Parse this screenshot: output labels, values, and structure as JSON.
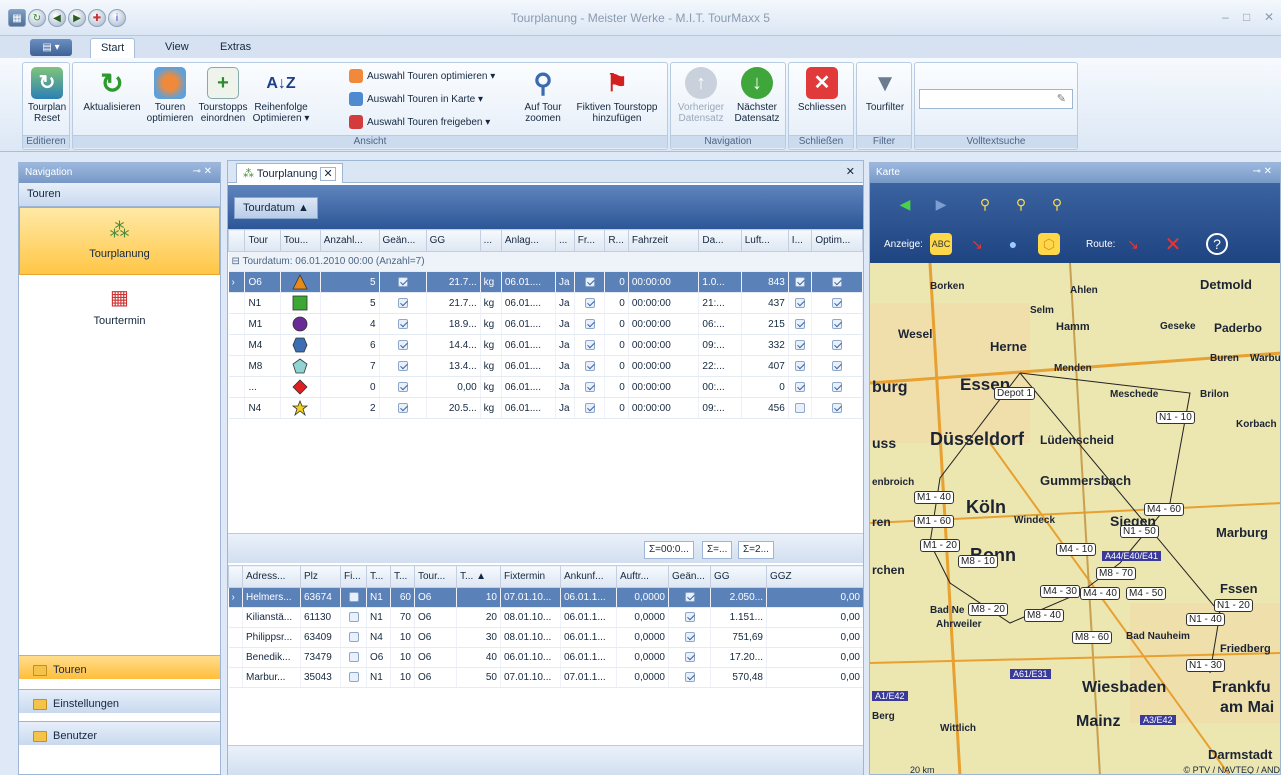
{
  "window": {
    "title": "Tourplanung - Meister Werke - M.I.T. TourMaxx 5",
    "controls": [
      "–",
      "□",
      "✕"
    ]
  },
  "ribbon": {
    "tabs": [
      "Start",
      "View",
      "Extras"
    ],
    "groups": {
      "edit": "Editieren",
      "view": "Ansicht",
      "nav": "Navigation",
      "close": "Schließen",
      "filter": "Filter",
      "search": "Volltextsuche"
    },
    "buttons": {
      "reset": "Tourplan\nReset",
      "refresh": "Aktualisieren",
      "optimize": "Touren\noptimieren",
      "stops": "Tourstopps\neinordnen",
      "order": "Reihenfolge\nOptimieren ▾",
      "zoom": "Auf Tour\nzoomen",
      "fictive": "Fiktiven Tourstopp\nhinzufügen",
      "prev": "Vorheriger\nDatensatz",
      "next": "Nächster\nDatensatz",
      "close": "Schliessen",
      "filter": "Tourfilter"
    },
    "small": [
      "Auswahl Touren optimieren ▾",
      "Auswahl Touren in Karte ▾",
      "Auswahl Touren freigeben ▾"
    ]
  },
  "nav": {
    "title": "Navigation",
    "section": "Touren",
    "items": [
      {
        "label": "Tourplanung"
      },
      {
        "label": "Tourtermin"
      }
    ],
    "bars": [
      "Touren",
      "Einstellungen",
      "Benutzer"
    ]
  },
  "doc": {
    "tab": "Tourplanung",
    "group_by": "Tourdatum  ▲",
    "group_row": "⊟ Tourdatum: 06.01.2010 00:00 (Anzahl=7)",
    "columns": [
      "Tour",
      "Tou...",
      "Anzahl...",
      "Geän...",
      "GG",
      "...",
      "Anlag...",
      "...",
      "Fr...",
      "R...",
      "Fahrzeit",
      "Da...",
      "Luft...",
      "I...",
      "Optim..."
    ],
    "rows": [
      {
        "tour": "O6",
        "shape": "triangle",
        "color": "#e88a1a",
        "anzahl": "5",
        "geaen": true,
        "gg": "21.7...",
        "unit": "kg",
        "anlag": "06.01....",
        "j": "Ja",
        "fr": true,
        "r": "0",
        "fahr": "00:00:00",
        "da": "1.0...",
        "luft": "843",
        "i": true,
        "opt": true
      },
      {
        "tour": "N1",
        "shape": "square",
        "color": "#3aa832",
        "anzahl": "5",
        "geaen": true,
        "gg": "21.7...",
        "unit": "kg",
        "anlag": "06.01....",
        "j": "Ja",
        "fr": true,
        "r": "0",
        "fahr": "00:00:00",
        "da": "21:...",
        "luft": "437",
        "i": true,
        "opt": true
      },
      {
        "tour": "M1",
        "shape": "circle",
        "color": "#6a2a96",
        "anzahl": "4",
        "geaen": true,
        "gg": "18.9...",
        "unit": "kg",
        "anlag": "06.01....",
        "j": "Ja",
        "fr": true,
        "r": "0",
        "fahr": "00:00:00",
        "da": "06:...",
        "luft": "215",
        "i": true,
        "opt": true
      },
      {
        "tour": "M4",
        "shape": "hexagon",
        "color": "#3d6db3",
        "anzahl": "6",
        "geaen": true,
        "gg": "14.4...",
        "unit": "kg",
        "anlag": "06.01....",
        "j": "Ja",
        "fr": true,
        "r": "0",
        "fahr": "00:00:00",
        "da": "09:...",
        "luft": "332",
        "i": true,
        "opt": true
      },
      {
        "tour": "M8",
        "shape": "pentagon",
        "color": "#8fd3d3",
        "anzahl": "7",
        "geaen": true,
        "gg": "13.4...",
        "unit": "kg",
        "anlag": "06.01....",
        "j": "Ja",
        "fr": true,
        "r": "0",
        "fahr": "00:00:00",
        "da": "22:...",
        "luft": "407",
        "i": true,
        "opt": true
      },
      {
        "tour": "...",
        "shape": "diamond",
        "color": "#e02020",
        "anzahl": "0",
        "geaen": true,
        "gg": "0,00",
        "unit": "kg",
        "anlag": "06.01....",
        "j": "Ja",
        "fr": true,
        "r": "0",
        "fahr": "00:00:00",
        "da": "00:...",
        "luft": "0",
        "i": true,
        "opt": true
      },
      {
        "tour": "N4",
        "shape": "star",
        "color": "#f2d21c",
        "anzahl": "2",
        "geaen": true,
        "gg": "20.5...",
        "unit": "kg",
        "anlag": "06.01....",
        "j": "Ja",
        "fr": true,
        "r": "0",
        "fahr": "00:00:00",
        "da": "09:...",
        "luft": "456",
        "i": false,
        "opt": true
      }
    ],
    "sums": [
      "Σ=00:0...",
      "Σ=...",
      "Σ=2..."
    ],
    "stop_columns": [
      "Adress...",
      "Plz",
      "Fi...",
      "T...",
      "T...",
      "Tour...",
      "T... ▲",
      "Fixtermin",
      "Ankunf...",
      "Auftr...",
      "Geän...",
      "GG",
      "GGZ"
    ],
    "stops": [
      {
        "adr": "Helmers...",
        "plz": "63674",
        "fi": false,
        "t1": "N1",
        "t2": "60",
        "tour": "O6",
        "t3": "10",
        "fix": "07.01.10...",
        "ank": "06.01.1...",
        "auf": "0,0000",
        "gea": true,
        "gg": "2.050...",
        "ggz": "0,00"
      },
      {
        "adr": "Kilianstä...",
        "plz": "61130",
        "fi": false,
        "t1": "N1",
        "t2": "70",
        "tour": "O6",
        "t3": "20",
        "fix": "08.01.10...",
        "ank": "06.01.1...",
        "auf": "0,0000",
        "gea": true,
        "gg": "1.151...",
        "ggz": "0,00"
      },
      {
        "adr": "Philippsr...",
        "plz": "63409",
        "fi": false,
        "t1": "N4",
        "t2": "10",
        "tour": "O6",
        "t3": "30",
        "fix": "08.01.10...",
        "ank": "06.01.1...",
        "auf": "0,0000",
        "gea": true,
        "gg": "751,69",
        "ggz": "0,00"
      },
      {
        "adr": "Benedik...",
        "plz": "73479",
        "fi": false,
        "t1": "O6",
        "t2": "10",
        "tour": "O6",
        "t3": "40",
        "fix": "06.01.10...",
        "ank": "06.01.1...",
        "auf": "0,0000",
        "gea": true,
        "gg": "17.20...",
        "ggz": "0,00"
      },
      {
        "adr": "Marbur...",
        "plz": "35043",
        "fi": false,
        "t1": "N1",
        "t2": "10",
        "tour": "O6",
        "t3": "50",
        "fix": "07.01.10...",
        "ank": "07.01.1...",
        "auf": "0,0000",
        "gea": true,
        "gg": "570,48",
        "ggz": "0,00"
      }
    ]
  },
  "map": {
    "title": "Karte",
    "anzeige": "Anzeige:",
    "route": "Route:",
    "cities": [
      "Borken",
      "Ahlen",
      "Detmold",
      "Selm",
      "Wesel",
      "Hamm",
      "Geseke",
      "Paderbo",
      "Herne",
      "Buren",
      "Warbu",
      "Menden",
      "Essen",
      "Meschede",
      "Brilon",
      "Düsseldorf",
      "Lüdenscheid",
      "Korbach",
      "Gummersbach",
      "Köln",
      "Windeck",
      "Siegen",
      "Marburg",
      "Bonn",
      "Bad Ne",
      "Ahrweiler",
      "Bad Nauheim",
      "Friedberg",
      "Wiesbaden",
      "Frankfu",
      "am Mai",
      "Mainz",
      "Darmstadt",
      "Wittlich",
      "Fssen"
    ],
    "labels": [
      "Depot 1",
      "N1 - 10",
      "M1 - 40",
      "M4 - 60",
      "M1 - 60",
      "N1 - 50",
      "M1 - 20",
      "M8 - 10",
      "M4 - 10",
      "M4 - 30",
      "M4 - 40",
      "M4 - 50",
      "M8 - 20",
      "M8 - 40",
      "M8 - 60",
      "N1 - 40",
      "N1 - 30",
      "N1 - 20",
      "M8 - 70"
    ],
    "roads": [
      "A61/E31",
      "A3/E42",
      "A44/E40/E41",
      "A1/E42"
    ],
    "scale": "20 km",
    "copyright": "© PTV / NAVTEQ / AND",
    "other": [
      "burg",
      "ren",
      "rchen",
      "uss",
      "enbroich",
      "Berg"
    ]
  }
}
